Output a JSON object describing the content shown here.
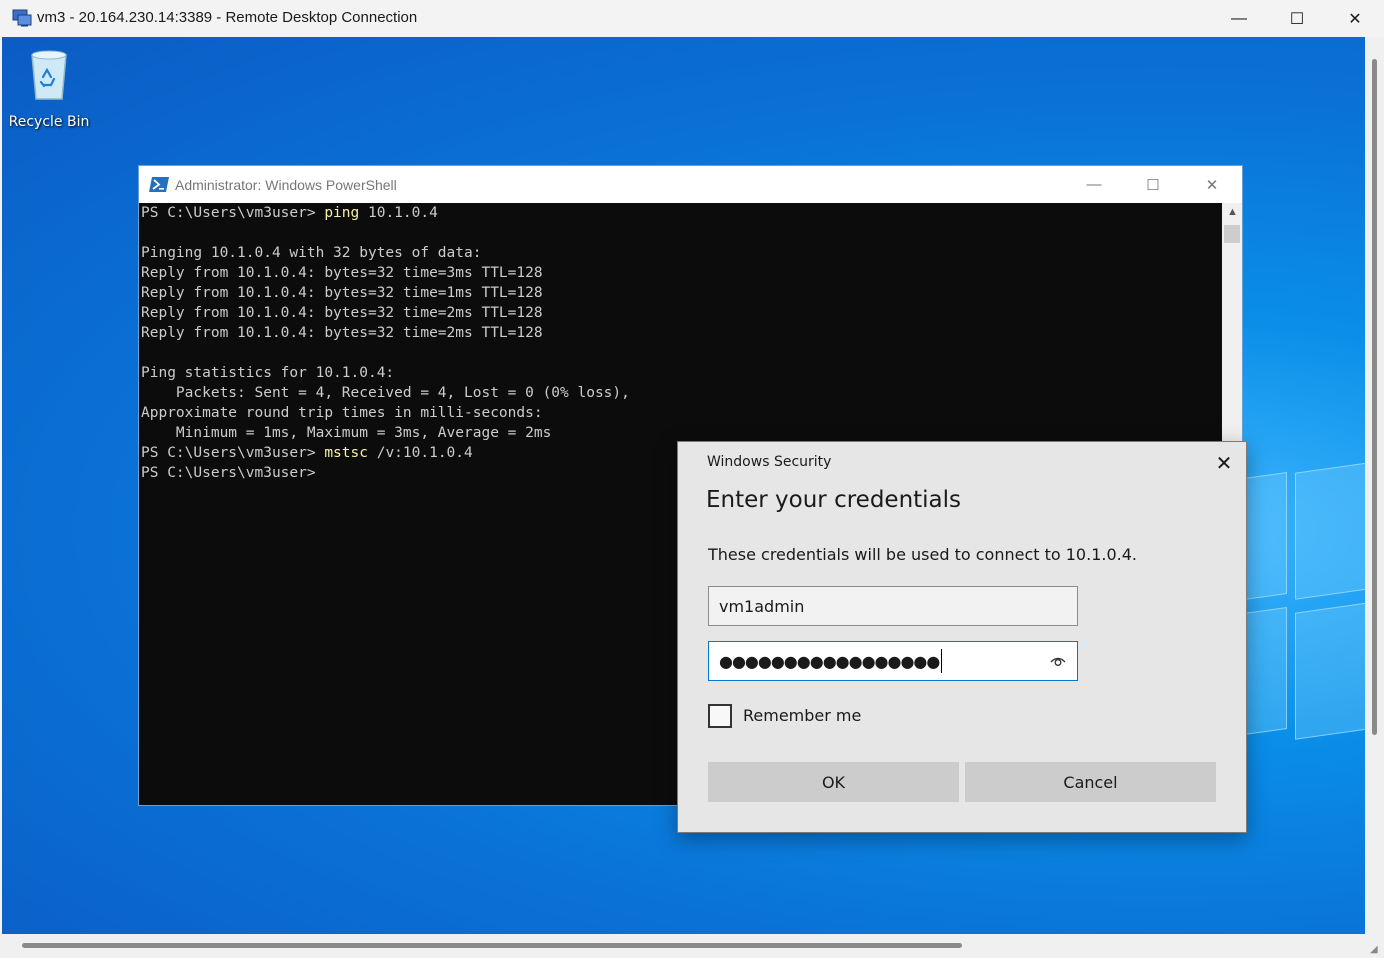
{
  "rdp_window": {
    "title": "vm3 - 20.164.230.14:3389 - Remote Desktop Connection",
    "icon": "remote-desktop-icon",
    "controls": {
      "minimize": "—",
      "maximize": "☐",
      "close": "✕"
    }
  },
  "desktop": {
    "icons": [
      {
        "label": "Recycle Bin",
        "icon": "recycle-bin-icon"
      }
    ],
    "colors": {
      "accent": "#0a73d8",
      "highlight": "#3fb7ff"
    }
  },
  "powershell": {
    "title": "Administrator: Windows PowerShell",
    "icon": "powershell-icon",
    "controls": {
      "minimize": "—",
      "maximize": "☐",
      "close": "✕"
    },
    "lines": [
      {
        "prompt": "PS C:\\Users\\vm3user> ",
        "command": "ping",
        "args": " 10.1.0.4"
      },
      {
        "text": ""
      },
      {
        "text": "Pinging 10.1.0.4 with 32 bytes of data:"
      },
      {
        "text": "Reply from 10.1.0.4: bytes=32 time=3ms TTL=128"
      },
      {
        "text": "Reply from 10.1.0.4: bytes=32 time=1ms TTL=128"
      },
      {
        "text": "Reply from 10.1.0.4: bytes=32 time=2ms TTL=128"
      },
      {
        "text": "Reply from 10.1.0.4: bytes=32 time=2ms TTL=128"
      },
      {
        "text": ""
      },
      {
        "text": "Ping statistics for 10.1.0.4:"
      },
      {
        "text": "    Packets: Sent = 4, Received = 4, Lost = 0 (0% loss),"
      },
      {
        "text": "Approximate round trip times in milli-seconds:"
      },
      {
        "text": "    Minimum = 1ms, Maximum = 3ms, Average = 2ms"
      },
      {
        "prompt": "PS C:\\Users\\vm3user> ",
        "command": "mstsc",
        "args": " /v:10.1.0.4"
      },
      {
        "prompt": "PS C:\\Users\\vm3user>",
        "command": "",
        "args": ""
      }
    ],
    "colors": {
      "background": "#0c0c0c",
      "text": "#cccccc",
      "command": "#f9f1a5"
    }
  },
  "security_dialog": {
    "caption": "Windows Security",
    "heading": "Enter your credentials",
    "description": "These credentials will be used to connect to 10.1.0.4.",
    "username": {
      "value": "vm1admin"
    },
    "password": {
      "masked_value": "●●●●●●●●●●●●●●●●●",
      "reveal_icon": "eye-icon"
    },
    "remember_me": {
      "label": "Remember me",
      "checked": false
    },
    "ok_label": "OK",
    "cancel_label": "Cancel",
    "close_glyph": "✕",
    "colors": {
      "focus_border": "#0078d4",
      "button": "#cccccc"
    }
  }
}
